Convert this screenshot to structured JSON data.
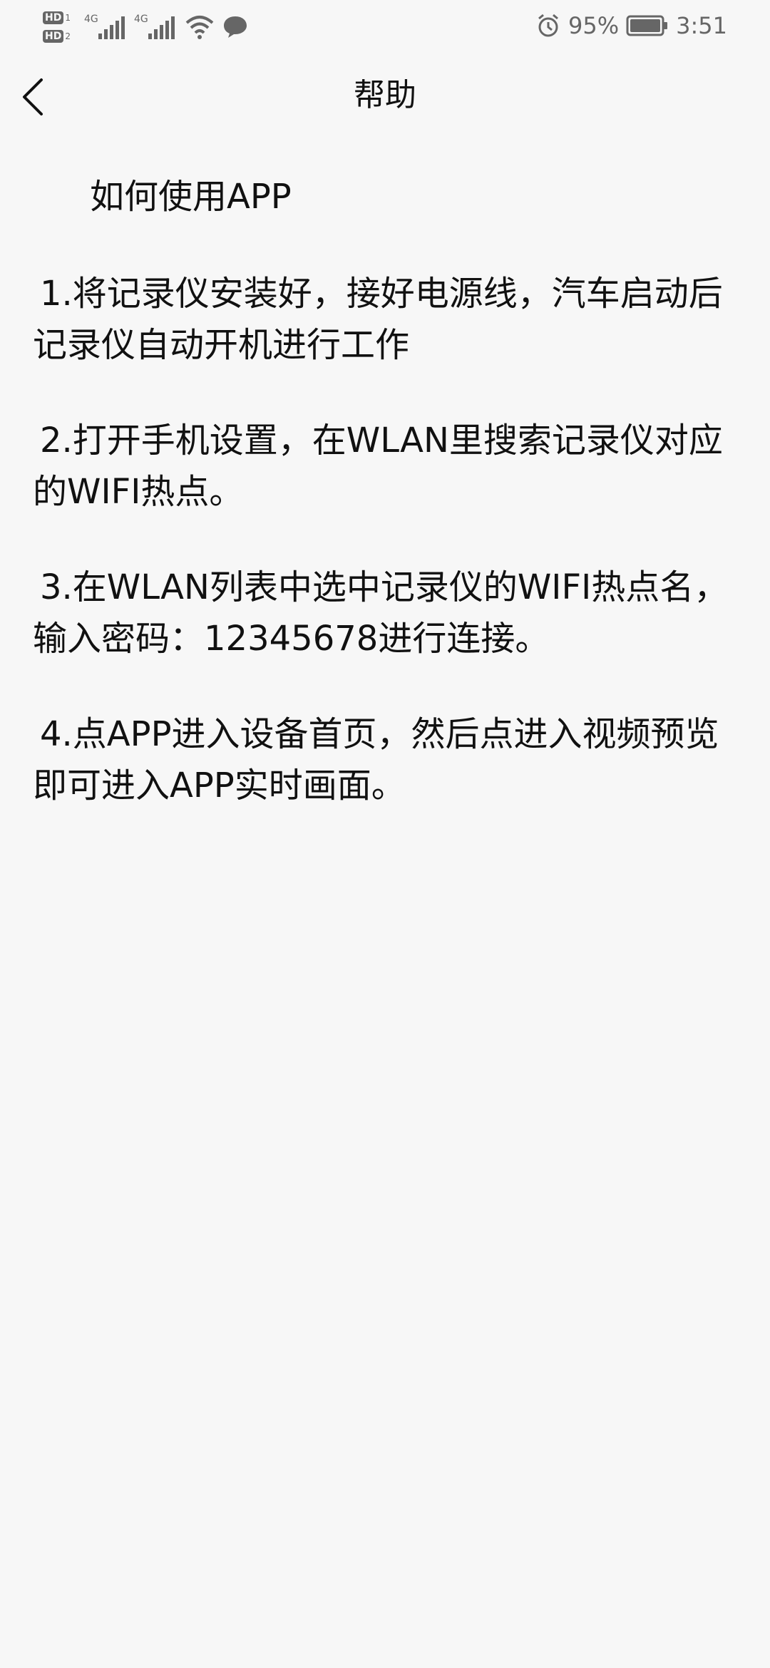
{
  "status_bar": {
    "hd_badge": "HD",
    "sim1": "1",
    "sim2": "2",
    "network1": "4G",
    "network2": "4G",
    "battery_percent": "95%",
    "time": "3:51",
    "icons": [
      "hd-icon",
      "signal-icon",
      "wifi-icon",
      "message-icon",
      "alarm-icon",
      "battery-icon"
    ]
  },
  "app_bar": {
    "title": "帮助",
    "back_icon": "chevron-left-icon"
  },
  "content": {
    "heading": "如何使用APP",
    "steps": [
      "1.将记录仪安装好，接好电源线，汽车启动后记录仪自动开机进行工作",
      "2.打开手机设置，在WLAN里搜索记录仪对应的WIFI热点。",
      "3.在WLAN列表中选中记录仪的WIFI热点名，输入密码：12345678进行连接。",
      "4.点APP进入设备首页，然后点进入视频预览即可进入APP实时画面。"
    ]
  }
}
